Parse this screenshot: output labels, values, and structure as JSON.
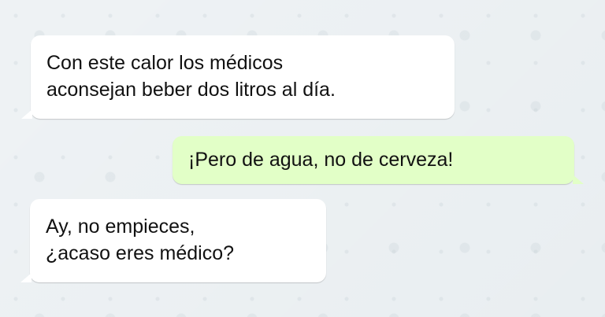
{
  "chat": {
    "messages": [
      {
        "direction": "incoming",
        "text": "Con este calor los médicos\naconsejan beber dos litros al día."
      },
      {
        "direction": "outgoing",
        "text": "¡Pero de agua, no de cerveza!"
      },
      {
        "direction": "incoming",
        "text": "Ay, no empieces,\n¿acaso eres médico?"
      }
    ]
  },
  "colors": {
    "background": "#e9eef1",
    "incoming_bubble": "#ffffff",
    "outgoing_bubble": "#e2ffc7",
    "text": "#111111"
  }
}
